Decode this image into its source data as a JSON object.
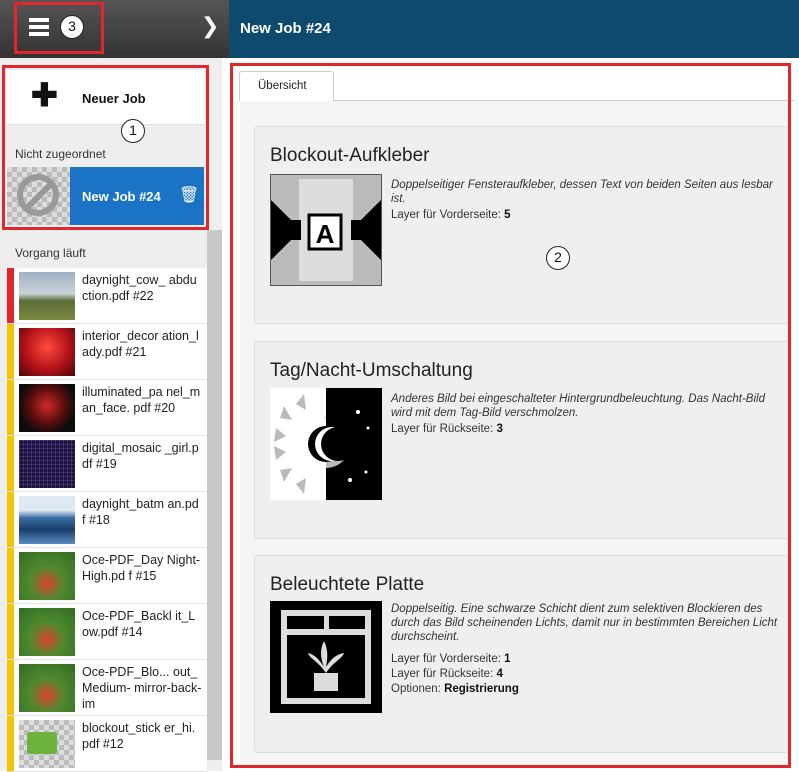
{
  "topbar": {
    "title": "New Job #24",
    "menu_callout": "3"
  },
  "sidebar": {
    "new_job_label": "Neuer Job",
    "callout_1": "1",
    "unassigned_label": "Nicht zugeordnet",
    "active_job": "New Job #24",
    "in_progress_label": "Vorgang läuft",
    "jobs": [
      {
        "name": "daynight_cow_ abduction.pdf #22",
        "status_color": "#e3262b"
      },
      {
        "name": "interior_decor ation_lady.pdf #21",
        "status_color": "#f2c500"
      },
      {
        "name": "illuminated_pa nel_man_face. pdf #20",
        "status_color": "#f2c500"
      },
      {
        "name": "digital_mosaic _girl.pdf #19",
        "status_color": "#f2c500"
      },
      {
        "name": "daynight_batm an.pdf #18",
        "status_color": "#f2c500"
      },
      {
        "name": "Oce-PDF_Day Night-High.pd f #15",
        "status_color": "#f2c500"
      },
      {
        "name": "Oce-PDF_Backl it_Low.pdf #14",
        "status_color": "#f2c500"
      },
      {
        "name": "Oce-PDF_Blo... out_Medium- mirror-back-im",
        "status_color": "#f2c500"
      },
      {
        "name": "blockout_stick er_hi.pdf #12",
        "status_color": "#f2c500"
      }
    ]
  },
  "main": {
    "tab_label": "Übersicht",
    "callout_2": "2",
    "cards": [
      {
        "title": "Blockout-Aufkleber",
        "description": "Doppelseitiger Fensteraufkleber, dessen Text von beiden Seiten aus lesbar ist.",
        "lines": [
          {
            "label": "Layer für Vorderseite: ",
            "value": "5"
          }
        ]
      },
      {
        "title": "Tag/Nacht-Umschaltung",
        "description": "Anderes Bild bei eingeschalteter Hintergrundbeleuchtung. Das Nacht-Bild wird mit dem Tag-Bild verschmolzen.",
        "lines": [
          {
            "label": "Layer für Rückseite: ",
            "value": "3"
          }
        ]
      },
      {
        "title": "Beleuchtete Platte",
        "description": "Doppelseitig. Eine schwarze Schicht dient zum selektiven Blockieren des durch das Bild scheinenden Lichts, damit nur in bestimmten Bereichen Licht durchscheint.",
        "lines": [
          {
            "label": "Layer für Vorderseite: ",
            "value": "1"
          },
          {
            "label": "Layer für Rückseite: ",
            "value": "4"
          },
          {
            "label": "Optionen: ",
            "value": "Registrierung"
          }
        ]
      }
    ]
  },
  "colors": {
    "topbar": "#0e4a6e",
    "active": "#1a73c4",
    "highlight_box": "#e3262b"
  }
}
